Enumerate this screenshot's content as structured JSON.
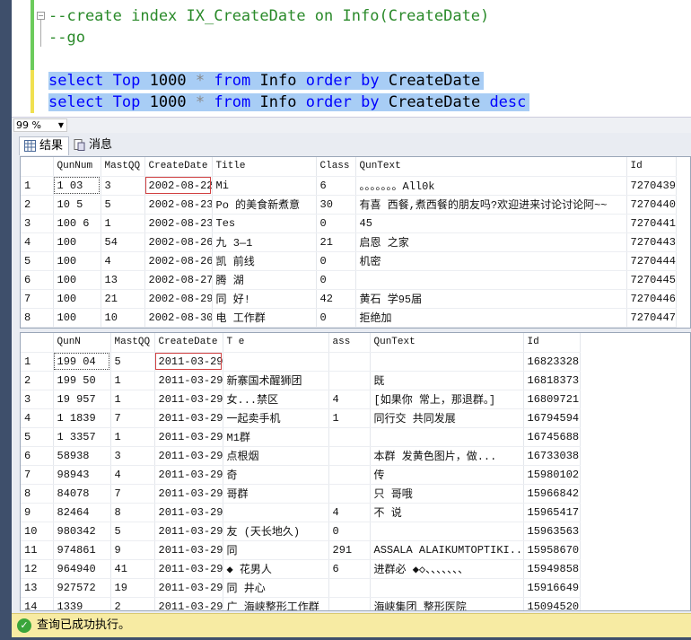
{
  "editor": {
    "lines": [
      {
        "tokens": [
          {
            "t": "--create index IX_CreateDate on Info(CreateDate)",
            "c": "cm"
          }
        ]
      },
      {
        "tokens": [
          {
            "t": "--go",
            "c": "cm"
          }
        ]
      },
      {
        "tokens": [
          {
            "t": "select",
            "c": "kw"
          },
          {
            "t": " ",
            "c": "tx"
          },
          {
            "t": "Top",
            "c": "kw"
          },
          {
            "t": " 1000 ",
            "c": "tx"
          },
          {
            "t": "*",
            "c": "op"
          },
          {
            "t": " ",
            "c": "tx"
          },
          {
            "t": "from",
            "c": "kw"
          },
          {
            "t": " Info ",
            "c": "tx"
          },
          {
            "t": "order",
            "c": "kw"
          },
          {
            "t": " ",
            "c": "tx"
          },
          {
            "t": "by",
            "c": "kw"
          },
          {
            "t": " CreateDate",
            "c": "tx"
          }
        ]
      },
      {
        "tokens": [
          {
            "t": "select",
            "c": "kw"
          },
          {
            "t": " ",
            "c": "tx"
          },
          {
            "t": "Top",
            "c": "kw"
          },
          {
            "t": " 1000 ",
            "c": "tx"
          },
          {
            "t": "*",
            "c": "op"
          },
          {
            "t": " ",
            "c": "tx"
          },
          {
            "t": "from",
            "c": "kw"
          },
          {
            "t": " Info ",
            "c": "tx"
          },
          {
            "t": "order",
            "c": "kw"
          },
          {
            "t": " ",
            "c": "tx"
          },
          {
            "t": "by",
            "c": "kw"
          },
          {
            "t": " CreateDate ",
            "c": "tx"
          },
          {
            "t": "desc",
            "c": "kw"
          }
        ]
      }
    ]
  },
  "zoom": {
    "value": "99 %"
  },
  "tabs": [
    {
      "label": "结果",
      "icon": "grid-icon"
    },
    {
      "label": "消息",
      "icon": "message-icon"
    }
  ],
  "grid1": {
    "columns": [
      "",
      "QunNum",
      "MastQQ",
      "CreateDate",
      "Title",
      "Class",
      "QunText",
      "Id"
    ],
    "rows": [
      [
        "1",
        "1 03",
        "3",
        "2002-08-22",
        "Mi",
        "6",
        "。。。。。。。All0k",
        "7270439"
      ],
      [
        "2",
        "10 5",
        "5",
        "2002-08-23",
        "Po 的美食新煮意",
        "30",
        "有喜 西餐,煮西餐的朋友吗?欢迎进来讨论讨论阿~~",
        "7270440"
      ],
      [
        "3",
        "100 6",
        "1",
        "2002-08-23",
        "Tes",
        "0",
        "45",
        "7270441"
      ],
      [
        "4",
        "100",
        "54",
        "2002-08-26",
        "九 3—1",
        "21",
        "启恩 之家",
        "7270443"
      ],
      [
        "5",
        "100",
        "4",
        "2002-08-26",
        "凯 前线",
        "0",
        "机密",
        "7270444"
      ],
      [
        "6",
        "100",
        "13",
        "2002-08-27",
        "腾 湖",
        "0",
        "",
        "7270445"
      ],
      [
        "7",
        "100",
        "21",
        "2002-08-29",
        "同 好!",
        "42",
        "黄石 学95届",
        "7270446"
      ],
      [
        "8",
        "100",
        "10",
        "2002-08-30",
        "电 工作群",
        "0",
        "拒绝加",
        "7270447"
      ]
    ]
  },
  "grid2": {
    "columns": [
      "",
      "QunN",
      "MastQQ",
      "CreateDate",
      "T e",
      "ass",
      "QunText",
      "Id"
    ],
    "rows": [
      [
        "1",
        "199 04",
        "5",
        "2011-03-29",
        "",
        "",
        "",
        "16823328"
      ],
      [
        "2",
        "199 50",
        "1",
        "2011-03-29",
        "新寨国术醒狮团",
        "",
        "既",
        "16818373"
      ],
      [
        "3",
        "19 957",
        "1",
        "2011-03-29",
        "女...禁区",
        "4",
        "[如果你 常上，那退群。]",
        "16809721"
      ],
      [
        "4",
        "1 1839",
        "7",
        "2011-03-29",
        "一起卖手机",
        "1",
        "同行交 共同发展",
        "16794594"
      ],
      [
        "5",
        "1 3357",
        "1",
        "2011-03-29",
        "M1群",
        "",
        "",
        "16745688"
      ],
      [
        "6",
        "58938",
        "3",
        "2011-03-29",
        "点根烟",
        "",
        "本群 发黄色图片，做...",
        "16733038"
      ],
      [
        "7",
        "98943",
        "4",
        "2011-03-29",
        "奇",
        "",
        "传",
        "15980102"
      ],
      [
        "8",
        "84078",
        "7",
        "2011-03-29",
        "哥群",
        "",
        "只 哥哦",
        "15966842"
      ],
      [
        "9",
        "82464",
        "8",
        "2011-03-29",
        "",
        "4",
        "不 说",
        "15965417"
      ],
      [
        "10",
        "980342",
        "5",
        "2011-03-29",
        "友 (天长地久)",
        "0",
        "",
        "15963563"
      ],
      [
        "11",
        "974861",
        "9",
        "2011-03-29",
        "同",
        "291",
        "ASSALA ALAIKUMTOPTIKI...",
        "15958670"
      ],
      [
        "12",
        "964940",
        "41",
        "2011-03-29",
        "◆ 花男人",
        "6",
        "进群必 ◆◇、、、、、、、",
        "15949858"
      ],
      [
        "13",
        "927572",
        "19",
        "2011-03-29",
        "同 井心",
        "",
        "",
        "15916649"
      ],
      [
        "14",
        "1339",
        "2",
        "2011-03-29",
        "广 海峡整形工作群",
        "",
        "海峡集团 整形医院",
        "15094520"
      ]
    ]
  },
  "status": {
    "text": "查询已成功执行。",
    "icon": "success-check-icon",
    "color": "#f7eba3"
  }
}
